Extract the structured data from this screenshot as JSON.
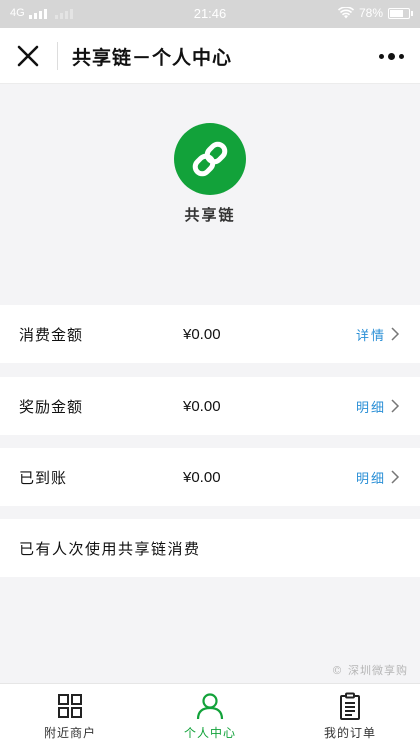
{
  "status_bar": {
    "network": "4G",
    "time": "21:46",
    "battery_text": "78%",
    "battery_level": 0.78
  },
  "nav": {
    "title": "共享链－个人中心"
  },
  "profile": {
    "brand_name": "共享链",
    "logo_color": "#12a23a"
  },
  "rows": [
    {
      "label": "消费金额",
      "value": "¥0.00",
      "link": "详情"
    },
    {
      "label": "奖励金额",
      "value": "¥0.00",
      "link": "明细"
    },
    {
      "label": "已到账",
      "value": "¥0.00",
      "link": "明细"
    }
  ],
  "notice": "已有人次使用共享链消费",
  "copyright": "© 深圳微享购",
  "tabs": [
    {
      "label": "附近商户",
      "icon": "grid-icon",
      "active": false
    },
    {
      "label": "个人中心",
      "icon": "user-icon",
      "active": true
    },
    {
      "label": "我的订单",
      "icon": "clipboard-icon",
      "active": false
    }
  ],
  "colors": {
    "accent_green": "#12a23a",
    "link_blue": "#2a8fd6"
  }
}
